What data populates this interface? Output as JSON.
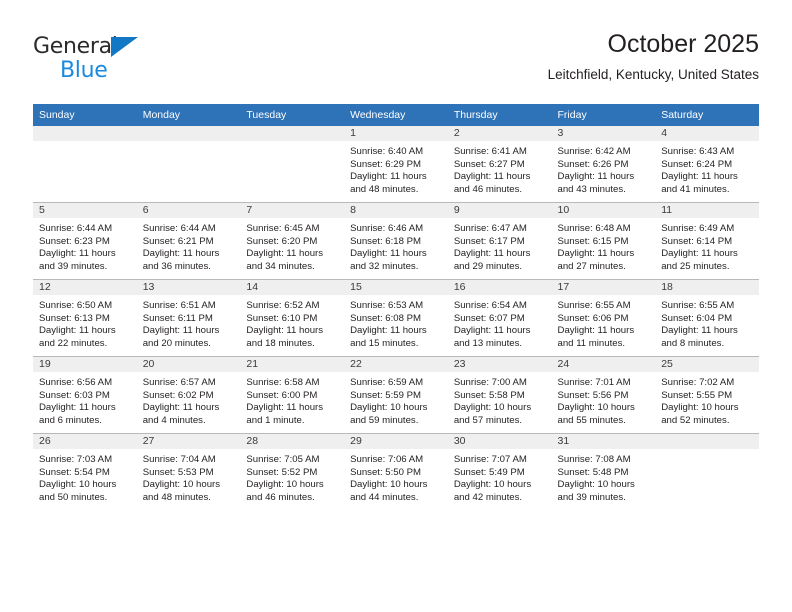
{
  "logo": {
    "word_one": "General",
    "word_two": "Blue",
    "triangle_color": "#1277c4",
    "word_two_color": "#1b8ade"
  },
  "header": {
    "title": "October 2025",
    "subtitle": "Leitchfield, Kentucky, United States"
  },
  "colors": {
    "header_blue": "#2e72b8",
    "daynum_band": "#efefef",
    "row_divider": "#b9b9b9",
    "text": "#231f20"
  },
  "weekday_headers": [
    "Sunday",
    "Monday",
    "Tuesday",
    "Wednesday",
    "Thursday",
    "Friday",
    "Saturday"
  ],
  "weeks": [
    [
      {
        "day": "",
        "empty": true,
        "sunrise": "",
        "sunset": "",
        "daylight_line1": "",
        "daylight_line2": ""
      },
      {
        "day": "",
        "empty": true,
        "sunrise": "",
        "sunset": "",
        "daylight_line1": "",
        "daylight_line2": ""
      },
      {
        "day": "",
        "empty": true,
        "sunrise": "",
        "sunset": "",
        "daylight_line1": "",
        "daylight_line2": ""
      },
      {
        "day": "1",
        "empty": false,
        "sunrise": "Sunrise: 6:40 AM",
        "sunset": "Sunset: 6:29 PM",
        "daylight_line1": "Daylight: 11 hours",
        "daylight_line2": "and 48 minutes."
      },
      {
        "day": "2",
        "empty": false,
        "sunrise": "Sunrise: 6:41 AM",
        "sunset": "Sunset: 6:27 PM",
        "daylight_line1": "Daylight: 11 hours",
        "daylight_line2": "and 46 minutes."
      },
      {
        "day": "3",
        "empty": false,
        "sunrise": "Sunrise: 6:42 AM",
        "sunset": "Sunset: 6:26 PM",
        "daylight_line1": "Daylight: 11 hours",
        "daylight_line2": "and 43 minutes."
      },
      {
        "day": "4",
        "empty": false,
        "sunrise": "Sunrise: 6:43 AM",
        "sunset": "Sunset: 6:24 PM",
        "daylight_line1": "Daylight: 11 hours",
        "daylight_line2": "and 41 minutes."
      }
    ],
    [
      {
        "day": "5",
        "empty": false,
        "sunrise": "Sunrise: 6:44 AM",
        "sunset": "Sunset: 6:23 PM",
        "daylight_line1": "Daylight: 11 hours",
        "daylight_line2": "and 39 minutes."
      },
      {
        "day": "6",
        "empty": false,
        "sunrise": "Sunrise: 6:44 AM",
        "sunset": "Sunset: 6:21 PM",
        "daylight_line1": "Daylight: 11 hours",
        "daylight_line2": "and 36 minutes."
      },
      {
        "day": "7",
        "empty": false,
        "sunrise": "Sunrise: 6:45 AM",
        "sunset": "Sunset: 6:20 PM",
        "daylight_line1": "Daylight: 11 hours",
        "daylight_line2": "and 34 minutes."
      },
      {
        "day": "8",
        "empty": false,
        "sunrise": "Sunrise: 6:46 AM",
        "sunset": "Sunset: 6:18 PM",
        "daylight_line1": "Daylight: 11 hours",
        "daylight_line2": "and 32 minutes."
      },
      {
        "day": "9",
        "empty": false,
        "sunrise": "Sunrise: 6:47 AM",
        "sunset": "Sunset: 6:17 PM",
        "daylight_line1": "Daylight: 11 hours",
        "daylight_line2": "and 29 minutes."
      },
      {
        "day": "10",
        "empty": false,
        "sunrise": "Sunrise: 6:48 AM",
        "sunset": "Sunset: 6:15 PM",
        "daylight_line1": "Daylight: 11 hours",
        "daylight_line2": "and 27 minutes."
      },
      {
        "day": "11",
        "empty": false,
        "sunrise": "Sunrise: 6:49 AM",
        "sunset": "Sunset: 6:14 PM",
        "daylight_line1": "Daylight: 11 hours",
        "daylight_line2": "and 25 minutes."
      }
    ],
    [
      {
        "day": "12",
        "empty": false,
        "sunrise": "Sunrise: 6:50 AM",
        "sunset": "Sunset: 6:13 PM",
        "daylight_line1": "Daylight: 11 hours",
        "daylight_line2": "and 22 minutes."
      },
      {
        "day": "13",
        "empty": false,
        "sunrise": "Sunrise: 6:51 AM",
        "sunset": "Sunset: 6:11 PM",
        "daylight_line1": "Daylight: 11 hours",
        "daylight_line2": "and 20 minutes."
      },
      {
        "day": "14",
        "empty": false,
        "sunrise": "Sunrise: 6:52 AM",
        "sunset": "Sunset: 6:10 PM",
        "daylight_line1": "Daylight: 11 hours",
        "daylight_line2": "and 18 minutes."
      },
      {
        "day": "15",
        "empty": false,
        "sunrise": "Sunrise: 6:53 AM",
        "sunset": "Sunset: 6:08 PM",
        "daylight_line1": "Daylight: 11 hours",
        "daylight_line2": "and 15 minutes."
      },
      {
        "day": "16",
        "empty": false,
        "sunrise": "Sunrise: 6:54 AM",
        "sunset": "Sunset: 6:07 PM",
        "daylight_line1": "Daylight: 11 hours",
        "daylight_line2": "and 13 minutes."
      },
      {
        "day": "17",
        "empty": false,
        "sunrise": "Sunrise: 6:55 AM",
        "sunset": "Sunset: 6:06 PM",
        "daylight_line1": "Daylight: 11 hours",
        "daylight_line2": "and 11 minutes."
      },
      {
        "day": "18",
        "empty": false,
        "sunrise": "Sunrise: 6:55 AM",
        "sunset": "Sunset: 6:04 PM",
        "daylight_line1": "Daylight: 11 hours",
        "daylight_line2": "and 8 minutes."
      }
    ],
    [
      {
        "day": "19",
        "empty": false,
        "sunrise": "Sunrise: 6:56 AM",
        "sunset": "Sunset: 6:03 PM",
        "daylight_line1": "Daylight: 11 hours",
        "daylight_line2": "and 6 minutes."
      },
      {
        "day": "20",
        "empty": false,
        "sunrise": "Sunrise: 6:57 AM",
        "sunset": "Sunset: 6:02 PM",
        "daylight_line1": "Daylight: 11 hours",
        "daylight_line2": "and 4 minutes."
      },
      {
        "day": "21",
        "empty": false,
        "sunrise": "Sunrise: 6:58 AM",
        "sunset": "Sunset: 6:00 PM",
        "daylight_line1": "Daylight: 11 hours",
        "daylight_line2": "and 1 minute."
      },
      {
        "day": "22",
        "empty": false,
        "sunrise": "Sunrise: 6:59 AM",
        "sunset": "Sunset: 5:59 PM",
        "daylight_line1": "Daylight: 10 hours",
        "daylight_line2": "and 59 minutes."
      },
      {
        "day": "23",
        "empty": false,
        "sunrise": "Sunrise: 7:00 AM",
        "sunset": "Sunset: 5:58 PM",
        "daylight_line1": "Daylight: 10 hours",
        "daylight_line2": "and 57 minutes."
      },
      {
        "day": "24",
        "empty": false,
        "sunrise": "Sunrise: 7:01 AM",
        "sunset": "Sunset: 5:56 PM",
        "daylight_line1": "Daylight: 10 hours",
        "daylight_line2": "and 55 minutes."
      },
      {
        "day": "25",
        "empty": false,
        "sunrise": "Sunrise: 7:02 AM",
        "sunset": "Sunset: 5:55 PM",
        "daylight_line1": "Daylight: 10 hours",
        "daylight_line2": "and 52 minutes."
      }
    ],
    [
      {
        "day": "26",
        "empty": false,
        "sunrise": "Sunrise: 7:03 AM",
        "sunset": "Sunset: 5:54 PM",
        "daylight_line1": "Daylight: 10 hours",
        "daylight_line2": "and 50 minutes."
      },
      {
        "day": "27",
        "empty": false,
        "sunrise": "Sunrise: 7:04 AM",
        "sunset": "Sunset: 5:53 PM",
        "daylight_line1": "Daylight: 10 hours",
        "daylight_line2": "and 48 minutes."
      },
      {
        "day": "28",
        "empty": false,
        "sunrise": "Sunrise: 7:05 AM",
        "sunset": "Sunset: 5:52 PM",
        "daylight_line1": "Daylight: 10 hours",
        "daylight_line2": "and 46 minutes."
      },
      {
        "day": "29",
        "empty": false,
        "sunrise": "Sunrise: 7:06 AM",
        "sunset": "Sunset: 5:50 PM",
        "daylight_line1": "Daylight: 10 hours",
        "daylight_line2": "and 44 minutes."
      },
      {
        "day": "30",
        "empty": false,
        "sunrise": "Sunrise: 7:07 AM",
        "sunset": "Sunset: 5:49 PM",
        "daylight_line1": "Daylight: 10 hours",
        "daylight_line2": "and 42 minutes."
      },
      {
        "day": "31",
        "empty": false,
        "sunrise": "Sunrise: 7:08 AM",
        "sunset": "Sunset: 5:48 PM",
        "daylight_line1": "Daylight: 10 hours",
        "daylight_line2": "and 39 minutes."
      },
      {
        "day": "",
        "empty": true,
        "sunrise": "",
        "sunset": "",
        "daylight_line1": "",
        "daylight_line2": ""
      }
    ]
  ]
}
